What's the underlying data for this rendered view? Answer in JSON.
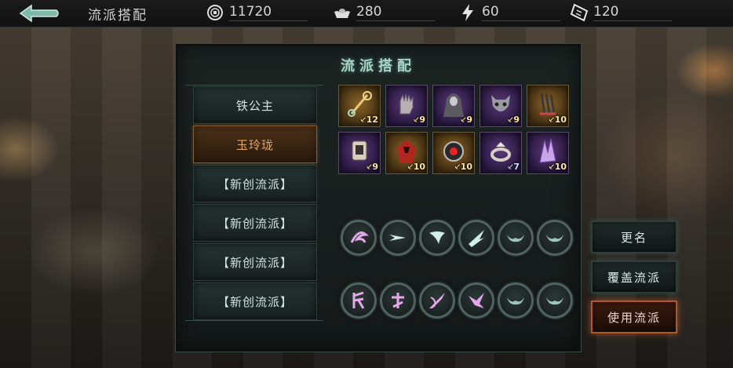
{
  "header": {
    "title": "流派搭配",
    "resources": [
      {
        "icon": "coin-icon",
        "value": "11720"
      },
      {
        "icon": "silver-ingot-icon",
        "value": "280"
      },
      {
        "icon": "lightning-icon",
        "value": "60"
      },
      {
        "icon": "ticket-icon",
        "value": "120"
      }
    ]
  },
  "panel": {
    "title": "流派搭配",
    "schools": [
      {
        "label": "铁公主",
        "active": false
      },
      {
        "label": "玉玲珑",
        "active": true
      },
      {
        "label": "【新创流派】",
        "active": false
      },
      {
        "label": "【新创流派】",
        "active": false
      },
      {
        "label": "【新创流派】",
        "active": false
      },
      {
        "label": "【新创流派】",
        "active": false
      }
    ],
    "equipment": [
      {
        "icon": "staff-icon",
        "level": "12",
        "rarity": "gold"
      },
      {
        "icon": "gauntlet-icon",
        "level": "9",
        "rarity": "purple"
      },
      {
        "icon": "hooded-robe-icon",
        "level": "9",
        "rarity": "purple"
      },
      {
        "icon": "horned-mask-icon",
        "level": "9",
        "rarity": "purple"
      },
      {
        "icon": "claw-weapon-icon",
        "level": "10",
        "rarity": "gold"
      },
      {
        "icon": "charm-talisman-icon",
        "level": "9",
        "rarity": "purple"
      },
      {
        "icon": "red-cloak-icon",
        "level": "10",
        "rarity": "gold"
      },
      {
        "icon": "red-gem-amulet-icon",
        "level": "10",
        "rarity": "gold"
      },
      {
        "icon": "ring-icon",
        "level": "7",
        "rarity": "purple"
      },
      {
        "icon": "purple-crystal-claw-icon",
        "level": "10",
        "rarity": "purple"
      }
    ],
    "skills_row1": [
      "swirl-skill-icon",
      "dash-skill-icon",
      "feather-skill-icon",
      "wing-strike-skill-icon",
      "horn-empty-skill-icon",
      "horn-empty-skill-icon"
    ],
    "skills_row2": [
      "rune-skill-icon",
      "cross-rune-skill-icon",
      "blade-skill-icon",
      "bird-skill-icon",
      "horn-empty-skill-icon",
      "horn-empty-skill-icon"
    ]
  },
  "actions": {
    "rename": "更名",
    "overwrite": "覆盖流派",
    "use": "使用流派"
  },
  "colors": {
    "accent": "#a9d2c4",
    "active_school": "#e6a763",
    "use_button": "#b0582a"
  }
}
